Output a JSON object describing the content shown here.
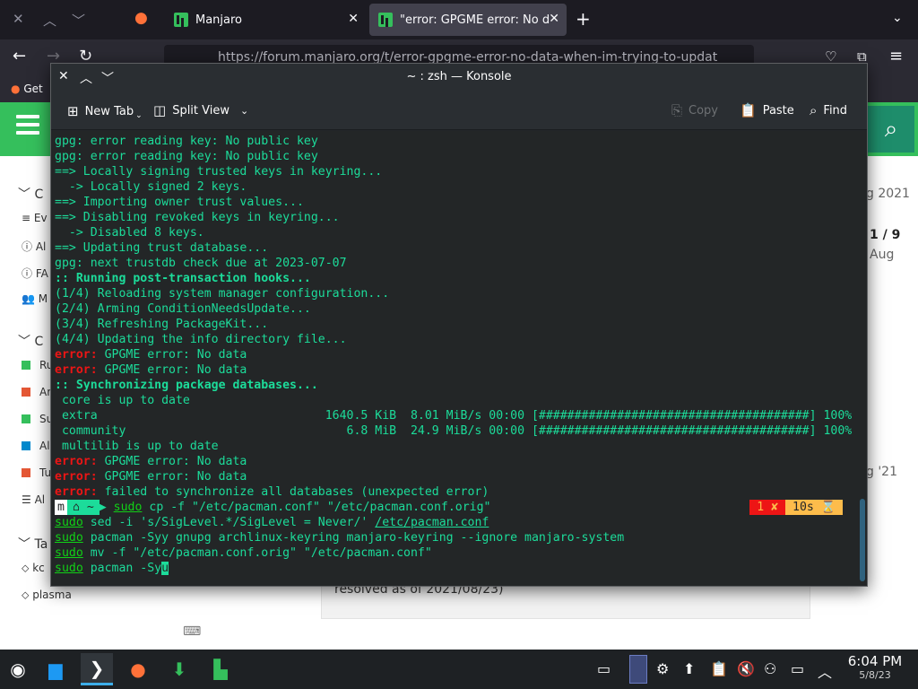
{
  "firefox": {
    "tabs": [
      {
        "label": "Manjaro",
        "selected": false
      },
      {
        "label": "\"error: GPGME error: No d",
        "selected": true
      }
    ],
    "url": "https://forum.manjaro.org/t/error-gpgme-error-no-data-when-im-trying-to-updat",
    "bookmark": "Get"
  },
  "forum": {
    "date_top": "g 2021",
    "counter": "1 / 9",
    "month": "Aug",
    "date_mid": "g '21",
    "post_snippet": "resolved as of 2021/08/23)",
    "side_items": [
      "C",
      "Ev",
      "Al",
      "FA",
      "M",
      "C",
      "Ru",
      "Ar",
      "Su",
      "Al",
      "Tu",
      "Al",
      "Ta",
      "kc",
      "plasma"
    ],
    "side_colors": {
      "ru": "#35bf5c",
      "ar": "#e45735",
      "su": "#35bf5c",
      "al": "#0088cc",
      "tu": "#e45735"
    }
  },
  "konsole": {
    "title": "~ : zsh — Konsole",
    "toolbar": {
      "new_tab": "New Tab",
      "split_view": "Split View",
      "copy": "Copy",
      "paste": "Paste",
      "find": "Find"
    },
    "output": [
      {
        "t": "gpg: error reading key: No public key",
        "c": "c-cyan"
      },
      {
        "t": "gpg: error reading key: No public key",
        "c": "c-cyan"
      },
      {
        "t": "==> Locally signing trusted keys in keyring...",
        "c": "c-cyan"
      },
      {
        "t": "  -> Locally signed 2 keys.",
        "c": "c-cyan"
      },
      {
        "t": "==> Importing owner trust values...",
        "c": "c-cyan"
      },
      {
        "t": "==> Disabling revoked keys in keyring...",
        "c": "c-cyan"
      },
      {
        "t": "  -> Disabled 8 keys.",
        "c": "c-cyan"
      },
      {
        "t": "==> Updating trust database...",
        "c": "c-cyan"
      },
      {
        "t": "gpg: next trustdb check due at 2023-07-07",
        "c": "c-cyan"
      },
      {
        "t": ":: Running post-transaction hooks...",
        "c": "c-bold"
      },
      {
        "t": "(1/4) Reloading system manager configuration...",
        "c": "c-cyan"
      },
      {
        "t": "(2/4) Arming ConditionNeedsUpdate...",
        "c": "c-cyan"
      },
      {
        "t": "(3/4) Refreshing PackageKit...",
        "c": "c-cyan"
      },
      {
        "t": "(4/4) Updating the info directory file...",
        "c": "c-cyan"
      },
      {
        "t": "error: GPGME error: No data",
        "c": "mixed-error"
      },
      {
        "t": "error: GPGME error: No data",
        "c": "mixed-error"
      },
      {
        "t": ":: Synchronizing package databases...",
        "c": "c-bold"
      },
      {
        "t": " core is up to date",
        "c": "c-cyan"
      },
      {
        "t": " extra                                1640.5 KiB  8.01 MiB/s 00:00 [######################################] 100%",
        "c": "c-cyan"
      },
      {
        "t": " community                               6.8 MiB  24.9 MiB/s 00:00 [######################################] 100%",
        "c": "c-cyan"
      },
      {
        "t": " multilib is up to date",
        "c": "c-cyan"
      },
      {
        "t": "error: GPGME error: No data",
        "c": "mixed-error"
      },
      {
        "t": "error: GPGME error: No data",
        "c": "mixed-error"
      },
      {
        "t": "error: failed to synchronize all databases (unexpected error)",
        "c": "mixed-error"
      }
    ],
    "prompt": {
      "distro_glyph": "m",
      "home": "~",
      "command": "sudo cp -f \"/etc/pacman.conf\" \"/etc/pacman.conf.orig\"",
      "exit_status": "1 ✘",
      "duration": "10s ⌛"
    },
    "commands": [
      {
        "sudo": "sudo",
        "rest": " sed -i 's/SigLevel.*/SigLevel = Never/' ",
        "path": "/etc/pacman.conf"
      },
      {
        "sudo": "sudo",
        "rest": " pacman -Syy gnupg archlinux-keyring manjaro-keyring --ignore manjaro-system",
        "path": ""
      },
      {
        "sudo": "sudo",
        "rest": " mv -f \"/etc/pacman.conf.orig\" \"/etc/pacman.conf\"",
        "path": ""
      },
      {
        "sudo": "sudo",
        "rest": " pacman -Sy",
        "path": "",
        "cursor": "u"
      }
    ]
  },
  "taskbar": {
    "time": "6:04 PM",
    "date": "5/8/23",
    "apps": [
      "app-launcher",
      "file-manager",
      "terminal",
      "firefox",
      "software-updater",
      "manjaro"
    ],
    "tray": [
      "keyboard-icon",
      "desktop-pager",
      "network-icon",
      "updates-icon",
      "clipboard-icon",
      "mute-icon",
      "bluetooth-icon",
      "display-icon",
      "expand-tray-icon"
    ]
  }
}
